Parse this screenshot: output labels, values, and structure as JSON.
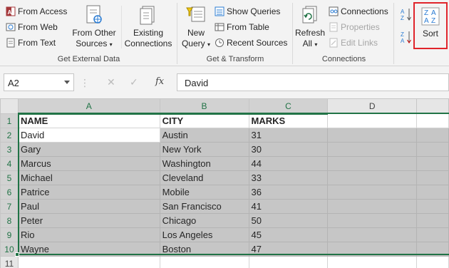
{
  "ribbon": {
    "get_external_data": {
      "from_access": "From Access",
      "from_web": "From Web",
      "from_text": "From Text",
      "from_other_sources_l1": "From Other",
      "from_other_sources_l2": "Sources",
      "existing_l1": "Existing",
      "existing_l2": "Connections",
      "label": "Get External Data"
    },
    "get_transform": {
      "new_query_l1": "New",
      "new_query_l2": "Query",
      "show_queries": "Show Queries",
      "from_table": "From Table",
      "recent_sources": "Recent Sources",
      "label": "Get & Transform"
    },
    "connections": {
      "refresh_l1": "Refresh",
      "refresh_l2": "All",
      "connections": "Connections",
      "properties": "Properties",
      "edit_links": "Edit Links",
      "label": "Connections"
    },
    "sort": {
      "label": "Sort",
      "highlight_color": "#e0242b"
    }
  },
  "formula_bar": {
    "name_box": "A2",
    "fx": "fx",
    "value": "David"
  },
  "sheet": {
    "columns": [
      "A",
      "B",
      "C",
      "D"
    ],
    "row_numbers": [
      "1",
      "2",
      "3",
      "4",
      "5",
      "6",
      "7",
      "8",
      "9",
      "10",
      "11"
    ],
    "header": [
      "NAME",
      "CITY",
      "MARKS"
    ],
    "rows": [
      [
        "David",
        "Austin",
        "31"
      ],
      [
        "Gary",
        "New York",
        "30"
      ],
      [
        "Marcus",
        "Washington",
        "44"
      ],
      [
        "Michael",
        "Cleveland",
        "33"
      ],
      [
        "Patrice",
        "Mobile",
        "36"
      ],
      [
        "Paul",
        "San Francisco",
        "41"
      ],
      [
        "Peter",
        "Chicago",
        "50"
      ],
      [
        "Rio",
        "Los Angeles",
        "45"
      ],
      [
        "Wayne",
        "Boston",
        "47"
      ]
    ],
    "accent_color": "#217346"
  }
}
